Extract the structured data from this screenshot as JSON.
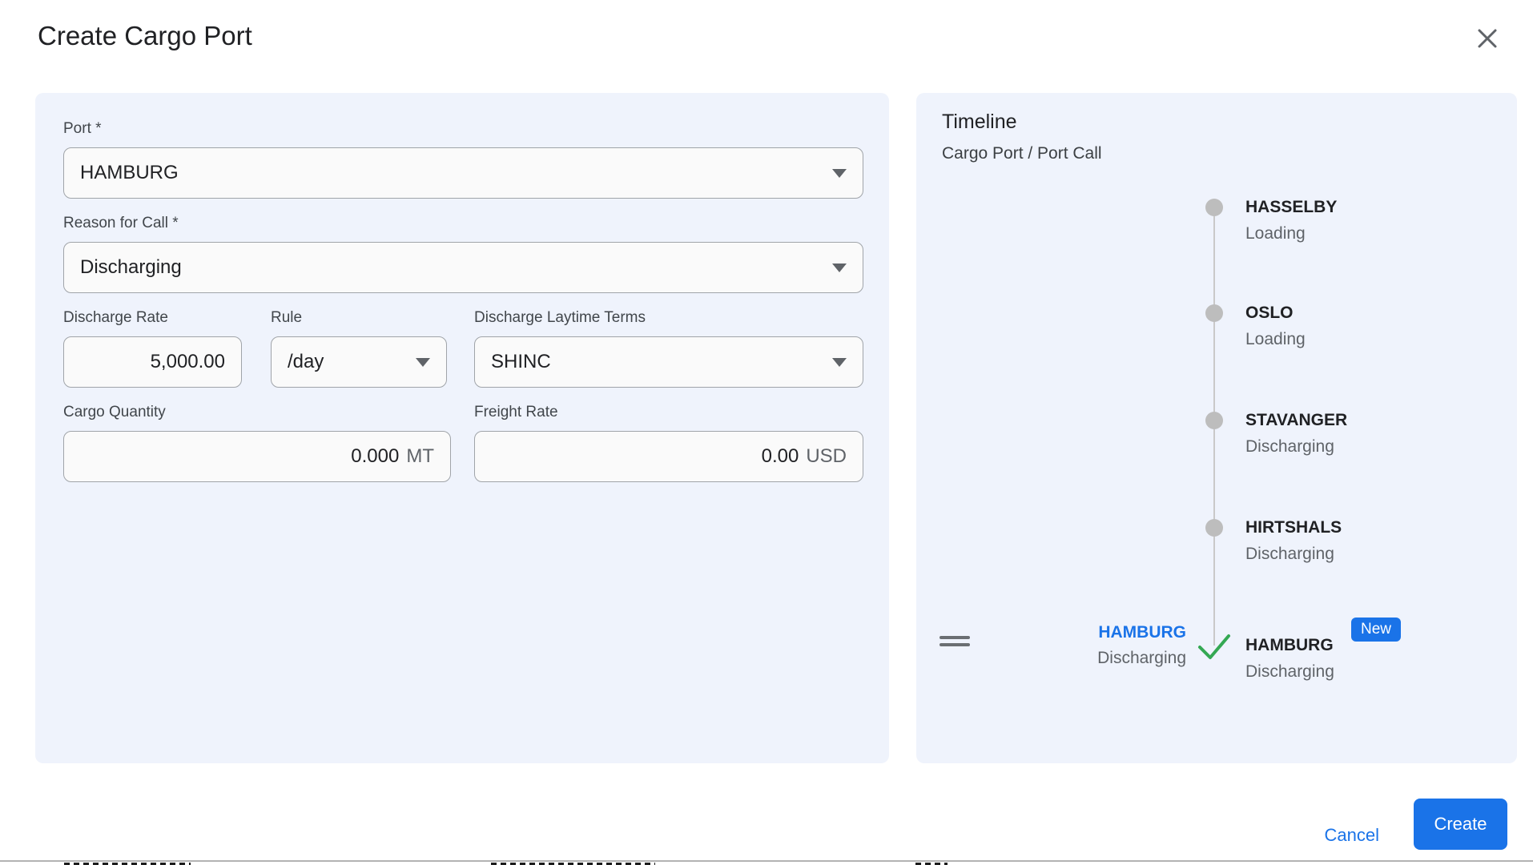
{
  "dialog": {
    "title": "Create Cargo Port"
  },
  "form": {
    "port": {
      "label": "Port *",
      "value": "HAMBURG"
    },
    "reason_for_call": {
      "label": "Reason for Call *",
      "value": "Discharging"
    },
    "discharge_rate": {
      "label": "Discharge Rate",
      "value": "5,000.00"
    },
    "rule": {
      "label": "Rule",
      "value": "/day"
    },
    "discharge_laytime_terms": {
      "label": "Discharge Laytime Terms",
      "value": "SHINC"
    },
    "cargo_quantity": {
      "label": "Cargo Quantity",
      "value": "0.000",
      "unit": "MT"
    },
    "freight_rate": {
      "label": "Freight Rate",
      "value": "0.00",
      "unit": "USD"
    }
  },
  "timeline": {
    "title": "Timeline",
    "subtitle": "Cargo Port / Port Call",
    "items": [
      {
        "port": "HASSELBY",
        "status": "Loading"
      },
      {
        "port": "OSLO",
        "status": "Loading"
      },
      {
        "port": "STAVANGER",
        "status": "Discharging"
      },
      {
        "port": "HIRTSHALS",
        "status": "Discharging"
      },
      {
        "port": "HAMBURG",
        "status": "Discharging",
        "badge": "New"
      }
    ],
    "dragged_item": {
      "port": "HAMBURG",
      "status": "Discharging"
    }
  },
  "footer": {
    "cancel_label": "Cancel",
    "create_label": "Create"
  },
  "colors": {
    "accent": "#1a73e8",
    "panel_bg": "#eff3fc",
    "success_green": "#34a853"
  }
}
